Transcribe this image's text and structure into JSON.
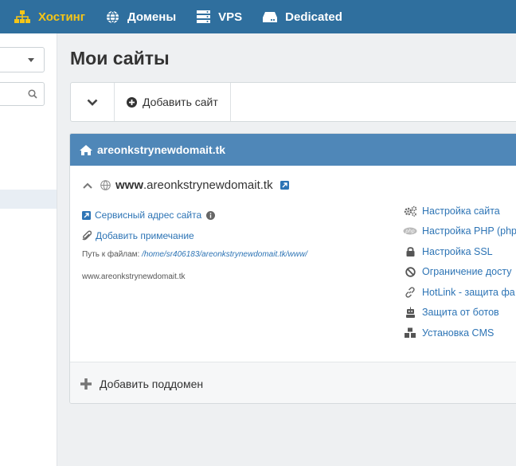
{
  "topnav": {
    "items": [
      {
        "label": "Хостинг",
        "icon": "sitemap-icon",
        "active": true
      },
      {
        "label": "Домены",
        "icon": "globe-icon"
      },
      {
        "label": "VPS",
        "icon": "server-icon"
      },
      {
        "label": "Dedicated",
        "icon": "hdd-icon"
      }
    ],
    "active_color": "#f5c518",
    "bg_color": "#2f6f9e"
  },
  "page": {
    "title": "Мои сайты"
  },
  "toolbar": {
    "add_site_label": "Добавить сайт"
  },
  "site": {
    "header_domain": "areonkstrynewdomait.tk",
    "www_prefix": "www",
    "www_domain": ".areonkstrynewdomait.tk",
    "service_address_label": "Сервисный адрес сайта",
    "add_note_label": "Добавить примечание",
    "path_label": "Путь к файлам:",
    "path_value": "/home/sr406183/areonkstrynewdomait.tk/www/",
    "mirror_domain": "www.areonkstrynewdomait.tk",
    "actions": [
      {
        "label": "Настройка сайта",
        "icon": "cogs-icon"
      },
      {
        "label": "Настройка PHP (php",
        "icon": "php-icon"
      },
      {
        "label": "Настройка SSL",
        "icon": "lock-icon"
      },
      {
        "label": "Ограничение досту",
        "icon": "ban-icon"
      },
      {
        "label": "HotLink - защита фа",
        "icon": "link-icon"
      },
      {
        "label": "Защита от ботов",
        "icon": "robot-icon"
      },
      {
        "label": "Установка CMS",
        "icon": "cubes-icon"
      }
    ],
    "add_subdomain_label": "Добавить поддомен",
    "header_color": "#4f87b8",
    "link_color": "#2d74b5"
  }
}
